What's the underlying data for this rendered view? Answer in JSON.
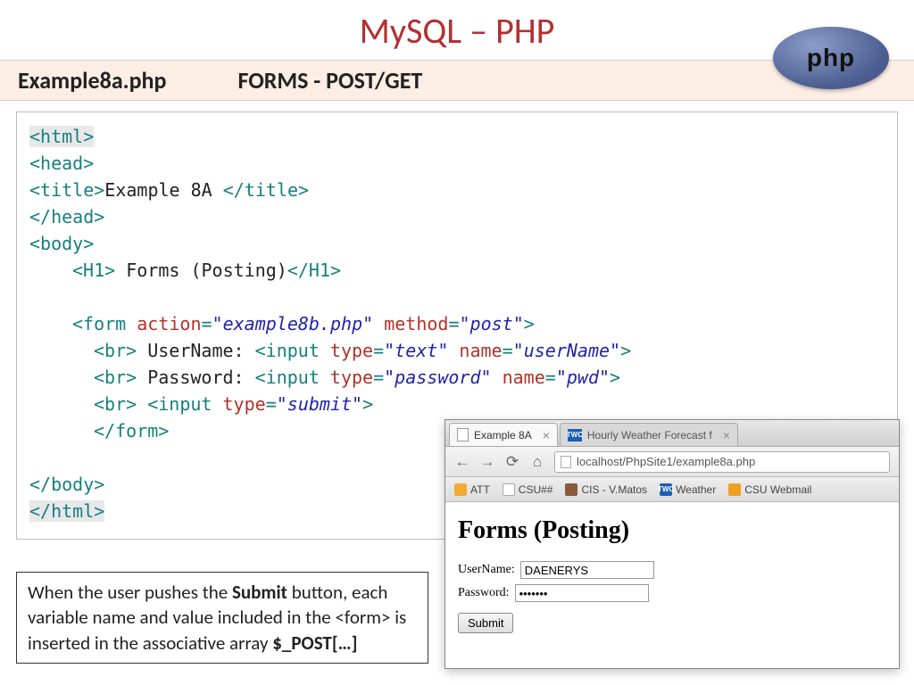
{
  "title": "MySQL – PHP",
  "subtitle": {
    "filename": "Example8a.php",
    "section": "FORMS  -  POST/GET"
  },
  "php_logo_text": "php",
  "code": {
    "l1_a": "<html>",
    "l2_a": "<head>",
    "l3_a": "<title>",
    "l3_b": "Example 8A ",
    "l3_c": "</title>",
    "l4_a": "</head>",
    "l5_a": "<body>",
    "l6_a": "<H1>",
    "l6_b": " Forms (Posting)",
    "l6_c": "</H1>",
    "l7_a": "<form ",
    "l7_b": "action",
    "l7_c": "=",
    "l7_d": "\"example8b.php\"",
    "l7_e": " method",
    "l7_f": "=",
    "l7_g": "\"post\"",
    "l7_h": ">",
    "l8_a": "<br>",
    "l8_b": " UserName:  ",
    "l8_c": "<input ",
    "l8_d": "type",
    "l8_e": "=",
    "l8_f": "\"text\"",
    "l8_g": " name",
    "l8_h": "=",
    "l8_i": "\"userName\"",
    "l8_j": ">",
    "l9_a": "<br>",
    "l9_b": " Password:  ",
    "l9_c": "<input ",
    "l9_d": "type",
    "l9_e": "=",
    "l9_f": "\"password\"",
    "l9_g": " name",
    "l9_h": "=",
    "l9_i": "\"pwd\"",
    "l9_j": ">",
    "l10_a": "<br>",
    "l10_b": " ",
    "l10_c": "<input ",
    "l10_d": "type",
    "l10_e": "=",
    "l10_f": "\"submit\"",
    "l10_g": ">",
    "l11_a": "</form>",
    "l12_a": "</body>",
    "l13_a": "</html>"
  },
  "caption": {
    "p1": "When the user pushes the ",
    "b1": "Submit",
    "p2": " button, each variable name and value included in the <form> is inserted in the associative array   ",
    "b2": "$_POST[…]"
  },
  "browser": {
    "tabs": [
      {
        "label": "Example 8A",
        "icon": "doc"
      },
      {
        "label": "Hourly Weather Forecast f",
        "icon": "twc"
      }
    ],
    "url": "localhost/PhpSite1/example8a.php",
    "bookmarks": [
      {
        "label": "ATT",
        "cls": "att"
      },
      {
        "label": "CSU##",
        "cls": "csu"
      },
      {
        "label": "CIS - V.Matos",
        "cls": "cis"
      },
      {
        "label": "Weather",
        "cls": "twc"
      },
      {
        "label": "CSU Webmail",
        "cls": "mail"
      }
    ],
    "page": {
      "heading": "Forms (Posting)",
      "username_label": "UserName:",
      "username_value": "DAENERYS",
      "password_label": "Password:",
      "password_value": "•••••••",
      "submit_label": "Submit"
    }
  }
}
